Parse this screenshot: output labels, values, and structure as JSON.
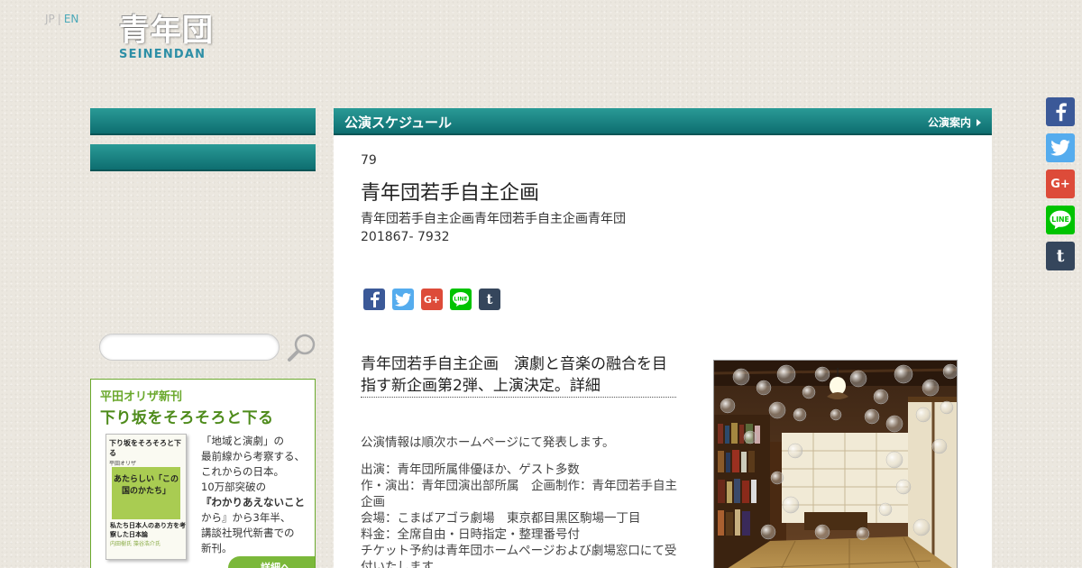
{
  "lang": {
    "jp": "JP",
    "separator": "|",
    "en": "EN"
  },
  "logo": {
    "kanji": "青年団",
    "roman": "SEINENDAN"
  },
  "search": {
    "placeholder": ""
  },
  "ad": {
    "kicker": "平田オリザ新刊",
    "title": "下り坂をそろそろと下る",
    "book": {
      "title": "下り坂をそろそろと下る",
      "author": "平田オリザ",
      "band": "あたらしい「この国のかたち」",
      "blurb": "私たち日本人のあり方を考察した日本論",
      "names": "内田樹氏 藻谷浩介氏"
    },
    "lines": [
      "「地域と演劇」の",
      "最前線から考察する、",
      "これからの日本。",
      "10万部突破の",
      "『わかりあえないこと",
      "から』から3年半、",
      "講談社現代新書での",
      "新刊。"
    ],
    "detail": "詳細へ"
  },
  "main": {
    "header_title": "公演スケジュール",
    "header_link": "公演案内",
    "number": "79",
    "title": "青年団若手自主企画",
    "subtitle": "青年団若手自主企画青年団若手自主企画青年団",
    "date": "201867- 7932",
    "heading": "青年団若手自主企画　演劇と音楽の融合を目指す新企画第2弾、上演決定。詳細",
    "body_paragraphs": [
      [
        "公演情報は順次ホームページにて発表します。"
      ],
      [
        "出演：青年団所属俳優ほか、ゲスト多数",
        "作・演出：青年団演出部所属　企画制作：青年団若手自主企画",
        "会場：こまばアゴラ劇場　東京都目黒区駒場一丁目",
        "料金：全席自由・日時指定・整理番号付",
        "チケット予約は青年団ホームページおよび劇場窓口にて受付いたします"
      ]
    ]
  },
  "share_icons": [
    "facebook-icon",
    "twitter-icon",
    "google-plus-icon",
    "line-icon",
    "tumblr-icon"
  ],
  "colors": {
    "teal": "#0e6e70",
    "facebook": "#3b5998",
    "twitter": "#55acee",
    "googleplus": "#dd4b39",
    "line": "#00c300",
    "tumblr": "#35465c",
    "ad_green": "#6aa82c"
  }
}
